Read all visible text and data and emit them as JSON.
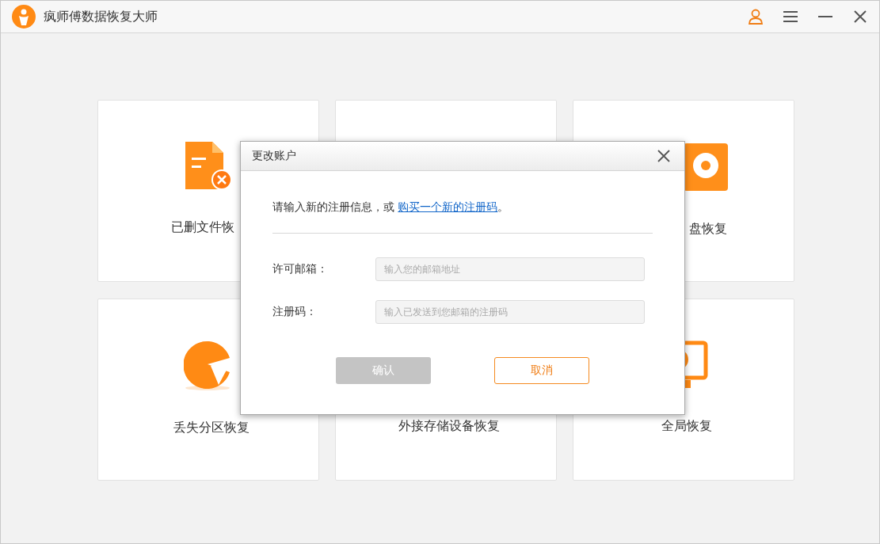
{
  "window": {
    "title": "疯师傅数据恢复大师"
  },
  "cards": [
    {
      "kind": "deleted-file",
      "label": "已删文件恢"
    },
    {
      "kind": "hidden"
    },
    {
      "kind": "disk",
      "label": "盘恢复"
    },
    {
      "kind": "partition",
      "label": "丢失分区恢复"
    },
    {
      "kind": "external",
      "label": "外接存储设备恢复"
    },
    {
      "kind": "global",
      "label": "全局恢复"
    }
  ],
  "dialog": {
    "title": "更改账户",
    "intro": "请输入新的注册信息，或",
    "link": "购买一个新的注册码",
    "intro_end": "。",
    "fields": [
      {
        "label": "许可邮箱：",
        "placeholder": "输入您的邮箱地址"
      },
      {
        "label": "注册码：",
        "placeholder": "输入已发送到您邮箱的注册码"
      }
    ],
    "confirm": {
      "label": "确认",
      "disabled": true
    },
    "cancel": {
      "label": "取消"
    }
  }
}
